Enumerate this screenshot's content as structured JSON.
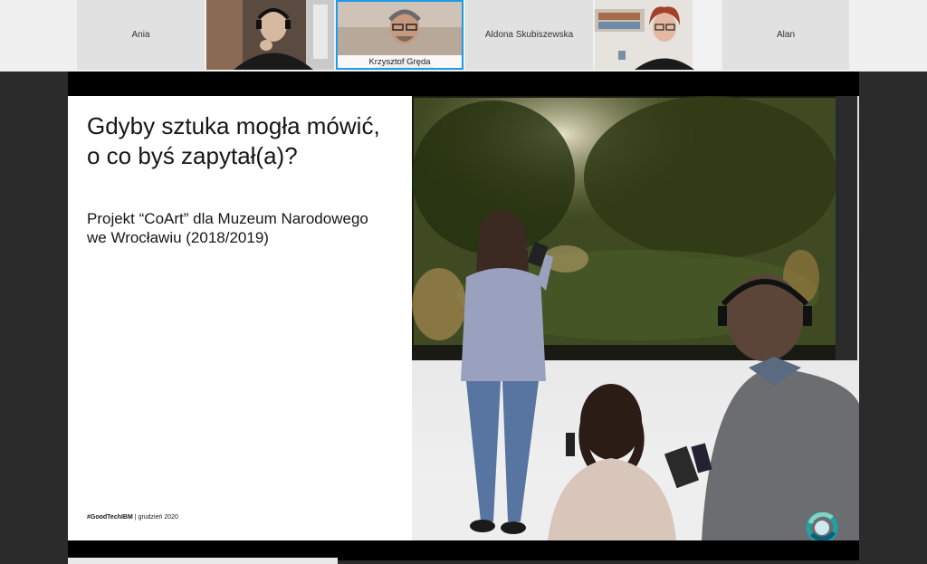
{
  "participants": [
    {
      "name": "Ania",
      "video": false
    },
    {
      "name": "",
      "video": true
    },
    {
      "name": "Krzysztof Gręda",
      "video": true,
      "active": true
    },
    {
      "name": "Aldona Skubiszewska",
      "video": false
    },
    {
      "name": "",
      "video": true
    },
    {
      "name": "Alan",
      "video": false
    }
  ],
  "slide": {
    "title": "Gdyby sztuka mogła mówić, o co byś zapytał(a)?",
    "subtitle": "Projekt “CoArt” dla Muzeum Narodowego we Wrocławiu (2018/2019)",
    "footer_tag": "#GoodTechIBM",
    "footer_date": "grudzień 2020"
  },
  "icons": {
    "presenter": "cloud-icon",
    "slide_logo": "ring-logo-icon"
  },
  "colors": {
    "active_border": "#1e9be8",
    "logo_teal": "#1aa5a5"
  }
}
